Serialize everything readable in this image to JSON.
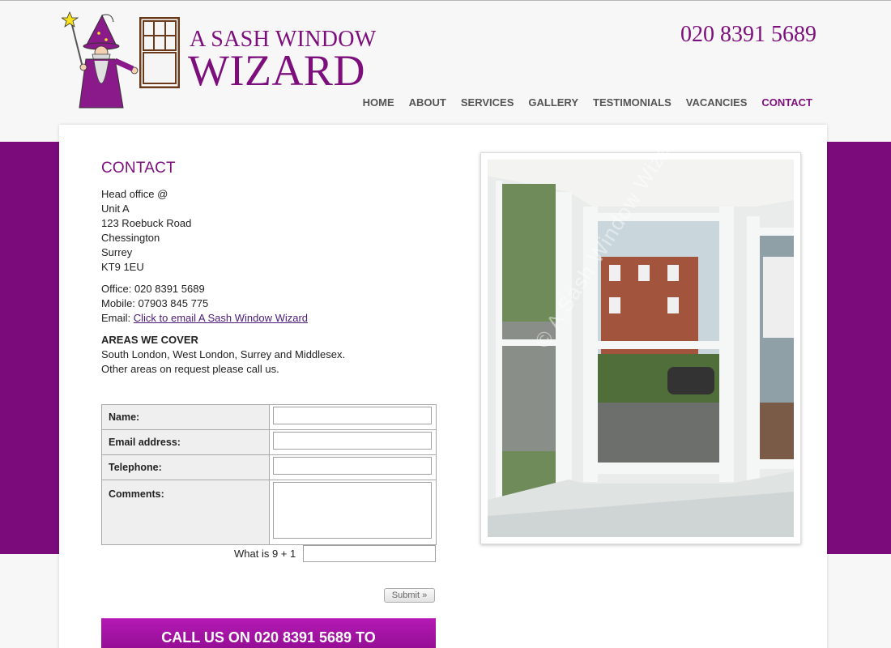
{
  "brand": {
    "line1": "A SASH WINDOW",
    "line2": "WIZARD",
    "phone": "020 8391 5689"
  },
  "nav": {
    "items": [
      {
        "label": "HOME"
      },
      {
        "label": "ABOUT"
      },
      {
        "label": "SERVICES"
      },
      {
        "label": "GALLERY"
      },
      {
        "label": "TESTIMONIALS"
      },
      {
        "label": "VACANCIES"
      },
      {
        "label": "CONTACT",
        "active": true
      }
    ]
  },
  "contact": {
    "title": "CONTACT",
    "address": [
      "Head office @",
      "Unit A",
      "123 Roebuck Road",
      "Chessington",
      "Surrey",
      "KT9 1EU"
    ],
    "office": "Office: 020 8391 5689",
    "mobile": "Mobile: 07903 845 775",
    "email_prefix": "Email: ",
    "email_link": "Click to email A Sash Window Wizard",
    "areas_heading": "AREAS WE COVER",
    "areas_line1": "South London, West London, Surrey and Middlesex.",
    "areas_line2": "Other areas on request please call us."
  },
  "form": {
    "name_label": "Name:",
    "email_label": "Email address:",
    "telephone_label": "Telephone:",
    "comments_label": "Comments:",
    "name_value": "",
    "email_value": "",
    "telephone_value": "",
    "comments_value": "",
    "captcha_label": "What is 9 + 1",
    "captcha_value": "",
    "submit_label": "Submit »"
  },
  "cta": {
    "text": "CALL US ON 020 8391 5689 TO"
  },
  "photo": {
    "watermark": "© A Sash Window Wizard"
  },
  "colors": {
    "brand_purple": "#7b0a7b",
    "cta_top": "#b419b4",
    "cta_bottom": "#8a0a8a"
  }
}
